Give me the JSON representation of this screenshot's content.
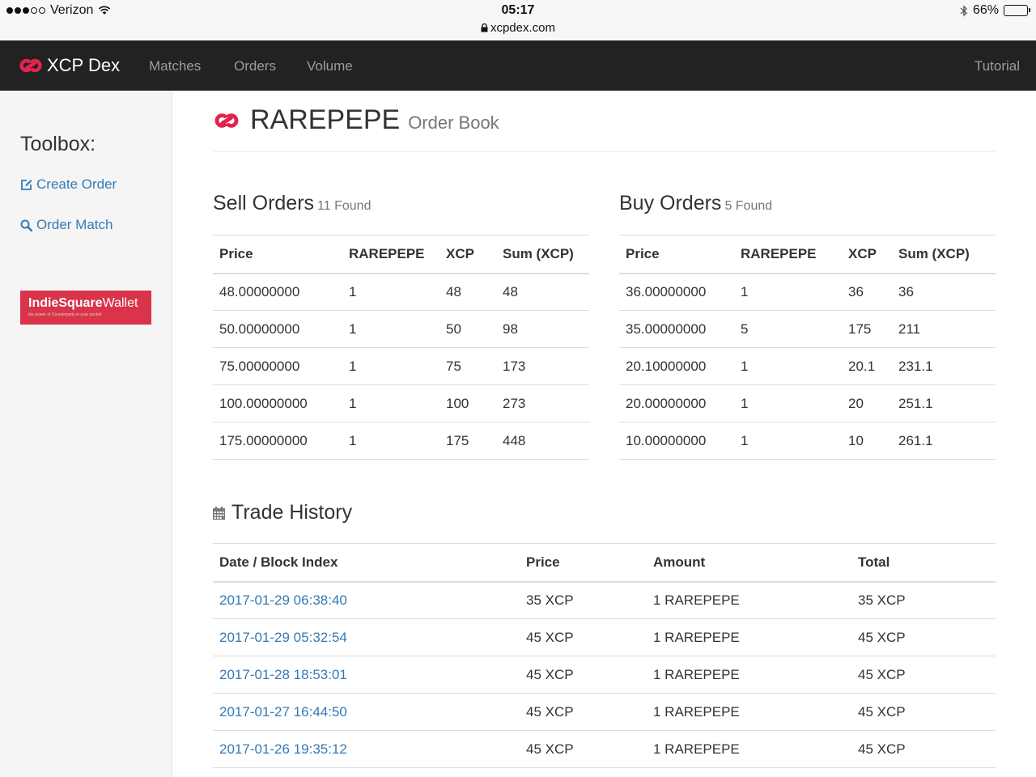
{
  "status_bar": {
    "carrier": "Verizon",
    "time": "05:17",
    "url": "xcpdex.com",
    "battery": "66%",
    "battery_level": 0.66
  },
  "navbar": {
    "brand": "XCP Dex",
    "items": [
      "Matches",
      "Orders",
      "Volume"
    ],
    "tutorial": "Tutorial"
  },
  "sidebar": {
    "title": "Toolbox:",
    "links": [
      "Create Order",
      "Order Match"
    ],
    "banner": {
      "bold": "IndieSquare",
      "normal": "Wallet",
      "tagline": "the power of Counterparty in your pocket"
    }
  },
  "header": {
    "title": "RAREPEPE",
    "subtitle": "Order Book"
  },
  "sell_orders": {
    "title": "Sell Orders",
    "count": "11 Found",
    "columns": [
      "Price",
      "RAREPEPE",
      "XCP",
      "Sum (XCP)"
    ],
    "rows": [
      [
        "48.00000000",
        "1",
        "48",
        "48"
      ],
      [
        "50.00000000",
        "1",
        "50",
        "98"
      ],
      [
        "75.00000000",
        "1",
        "75",
        "173"
      ],
      [
        "100.00000000",
        "1",
        "100",
        "273"
      ],
      [
        "175.00000000",
        "1",
        "175",
        "448"
      ]
    ]
  },
  "buy_orders": {
    "title": "Buy Orders",
    "count": "5 Found",
    "columns": [
      "Price",
      "RAREPEPE",
      "XCP",
      "Sum (XCP)"
    ],
    "rows": [
      [
        "36.00000000",
        "1",
        "36",
        "36"
      ],
      [
        "35.00000000",
        "5",
        "175",
        "211"
      ],
      [
        "20.10000000",
        "1",
        "20.1",
        "231.1"
      ],
      [
        "20.00000000",
        "1",
        "20",
        "251.1"
      ],
      [
        "10.00000000",
        "1",
        "10",
        "261.1"
      ]
    ]
  },
  "trade_history": {
    "title": "Trade History",
    "columns": [
      "Date / Block Index",
      "Price",
      "Amount",
      "Total"
    ],
    "rows": [
      [
        "2017-01-29 06:38:40",
        "35 XCP",
        "1 RAREPEPE",
        "35 XCP"
      ],
      [
        "2017-01-29 05:32:54",
        "45 XCP",
        "1 RAREPEPE",
        "45 XCP"
      ],
      [
        "2017-01-28 18:53:01",
        "45 XCP",
        "1 RAREPEPE",
        "45 XCP"
      ],
      [
        "2017-01-27 16:44:50",
        "45 XCP",
        "1 RAREPEPE",
        "45 XCP"
      ],
      [
        "2017-01-26 19:35:12",
        "45 XCP",
        "1 RAREPEPE",
        "45 XCP"
      ]
    ]
  },
  "colors": {
    "brand_red": "#e4234f",
    "link": "#337ab7",
    "navbar": "#222222"
  }
}
